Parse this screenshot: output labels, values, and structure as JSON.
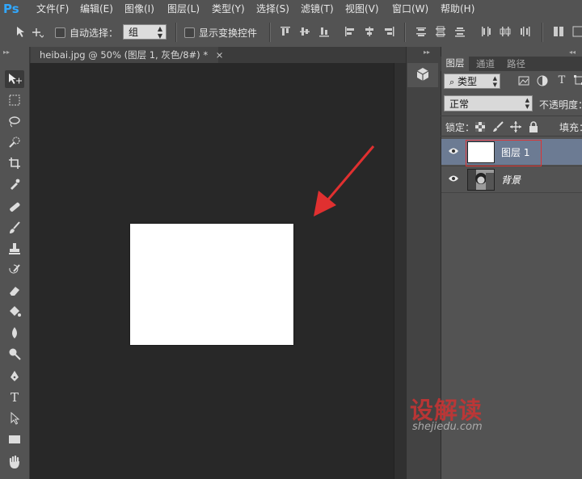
{
  "app": {
    "logo": "Ps"
  },
  "menu": [
    {
      "label": "文件(F)"
    },
    {
      "label": "编辑(E)"
    },
    {
      "label": "图像(I)"
    },
    {
      "label": "图层(L)"
    },
    {
      "label": "类型(Y)"
    },
    {
      "label": "选择(S)"
    },
    {
      "label": "滤镜(T)"
    },
    {
      "label": "视图(V)"
    },
    {
      "label": "窗口(W)"
    },
    {
      "label": "帮助(H)"
    }
  ],
  "options": {
    "auto_select_label": "自动选择：",
    "auto_select_checked": false,
    "group_value": "组",
    "show_transform_label": "显示变换控件",
    "show_transform_checked": false
  },
  "document": {
    "tab_title": "heibai.jpg @ 50% (图层 1, 灰色/8#) *",
    "close_glyph": "×"
  },
  "panel": {
    "tabs": [
      "图层",
      "通道",
      "路径"
    ],
    "active_tab": "图层",
    "kind_value": "类型",
    "blend_mode": "正常",
    "opacity_label": "不透明度：",
    "lock_label": "锁定：",
    "fill_label": "填充："
  },
  "layers": [
    {
      "name": "图层 1",
      "selected": true
    },
    {
      "name": "背景",
      "selected": false
    }
  ],
  "watermark": {
    "brand": "设解读",
    "url": "shejiedu.com"
  },
  "colors": {
    "chrome": "#535353",
    "canvas_bg": "#282828",
    "selected_layer": "#6c7b93",
    "arrow": "#e03030",
    "highlight_box": "#dd3333",
    "ps_blue": "#31a8ff"
  }
}
